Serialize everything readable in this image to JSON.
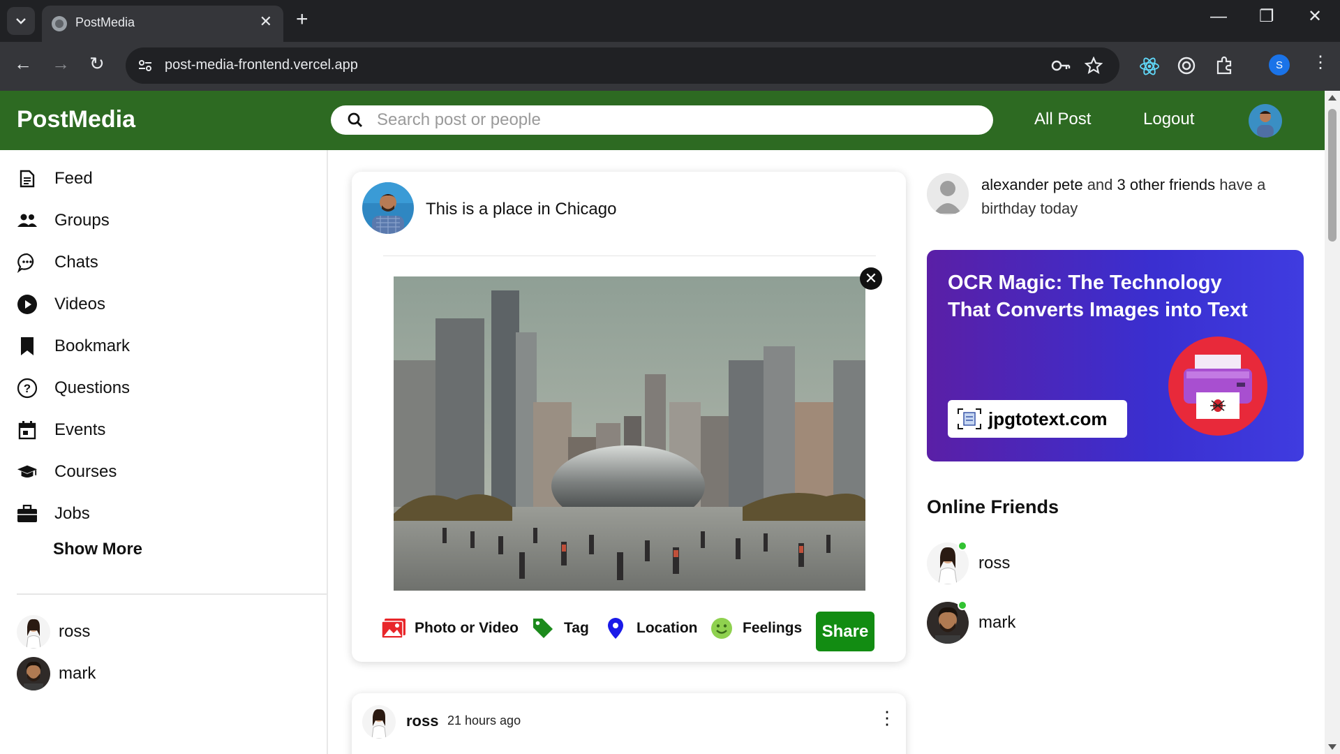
{
  "browser": {
    "tab_title": "PostMedia",
    "url": "post-media-frontend.vercel.app",
    "profile_initial": "S"
  },
  "header": {
    "logo": "PostMedia",
    "search_placeholder": "Search post or people",
    "nav_all_post": "All Post",
    "nav_logout": "Logout",
    "brand_color": "#2d6a22"
  },
  "sidebar": {
    "items": [
      {
        "label": "Feed",
        "icon": "feed-icon"
      },
      {
        "label": "Groups",
        "icon": "groups-icon"
      },
      {
        "label": "Chats",
        "icon": "chats-icon"
      },
      {
        "label": "Videos",
        "icon": "videos-icon"
      },
      {
        "label": "Bookmark",
        "icon": "bookmark-icon"
      },
      {
        "label": "Questions",
        "icon": "questions-icon"
      },
      {
        "label": "Events",
        "icon": "events-icon"
      },
      {
        "label": "Courses",
        "icon": "courses-icon"
      },
      {
        "label": "Jobs",
        "icon": "jobs-icon"
      }
    ],
    "show_more": "Show More",
    "friends": [
      {
        "name": "ross"
      },
      {
        "name": "mark"
      }
    ]
  },
  "share": {
    "text": "This is a place in Chicago",
    "options": [
      {
        "label": "Photo or Video",
        "icon": "photo-icon",
        "color": "#e8262a"
      },
      {
        "label": "Tag",
        "icon": "tag-icon",
        "color": "#1c8a1c"
      },
      {
        "label": "Location",
        "icon": "location-icon",
        "color": "#1a1ae8"
      },
      {
        "label": "Feelings",
        "icon": "feelings-icon",
        "color": "#f0a12b"
      }
    ],
    "share_button": "Share",
    "share_color": "#128c12"
  },
  "post": {
    "username": "ross",
    "time": "21 hours ago"
  },
  "rightbar": {
    "birthday": {
      "name": "alexander pete",
      "middle": "and",
      "others": "3 other friends",
      "suffix": "have a birthday today"
    },
    "ad": {
      "title": "OCR Magic: The Technology That Converts Images into Text",
      "badge": "jpgtotext.com"
    },
    "online_title": "Online Friends",
    "online_friends": [
      {
        "name": "ross"
      },
      {
        "name": "mark"
      }
    ],
    "online_color": "#32c232"
  }
}
